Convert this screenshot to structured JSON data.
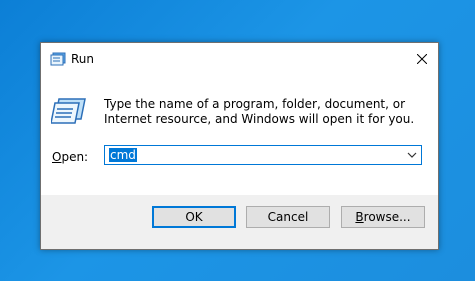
{
  "window": {
    "title": "Run",
    "icon": "run-icon",
    "close_icon": "close-icon"
  },
  "content": {
    "description": "Type the name of a program, folder, document, or Internet resource, and Windows will open it for you.",
    "open_label_accel": "O",
    "open_label_rest": "pen:",
    "open_value": "cmd"
  },
  "buttons": {
    "ok": "OK",
    "cancel": "Cancel",
    "browse_accel": "B",
    "browse_rest": "rowse..."
  },
  "colors": {
    "accent": "#0078d7",
    "desktop": "#1a8ad8",
    "footer": "#f0f0f0"
  }
}
